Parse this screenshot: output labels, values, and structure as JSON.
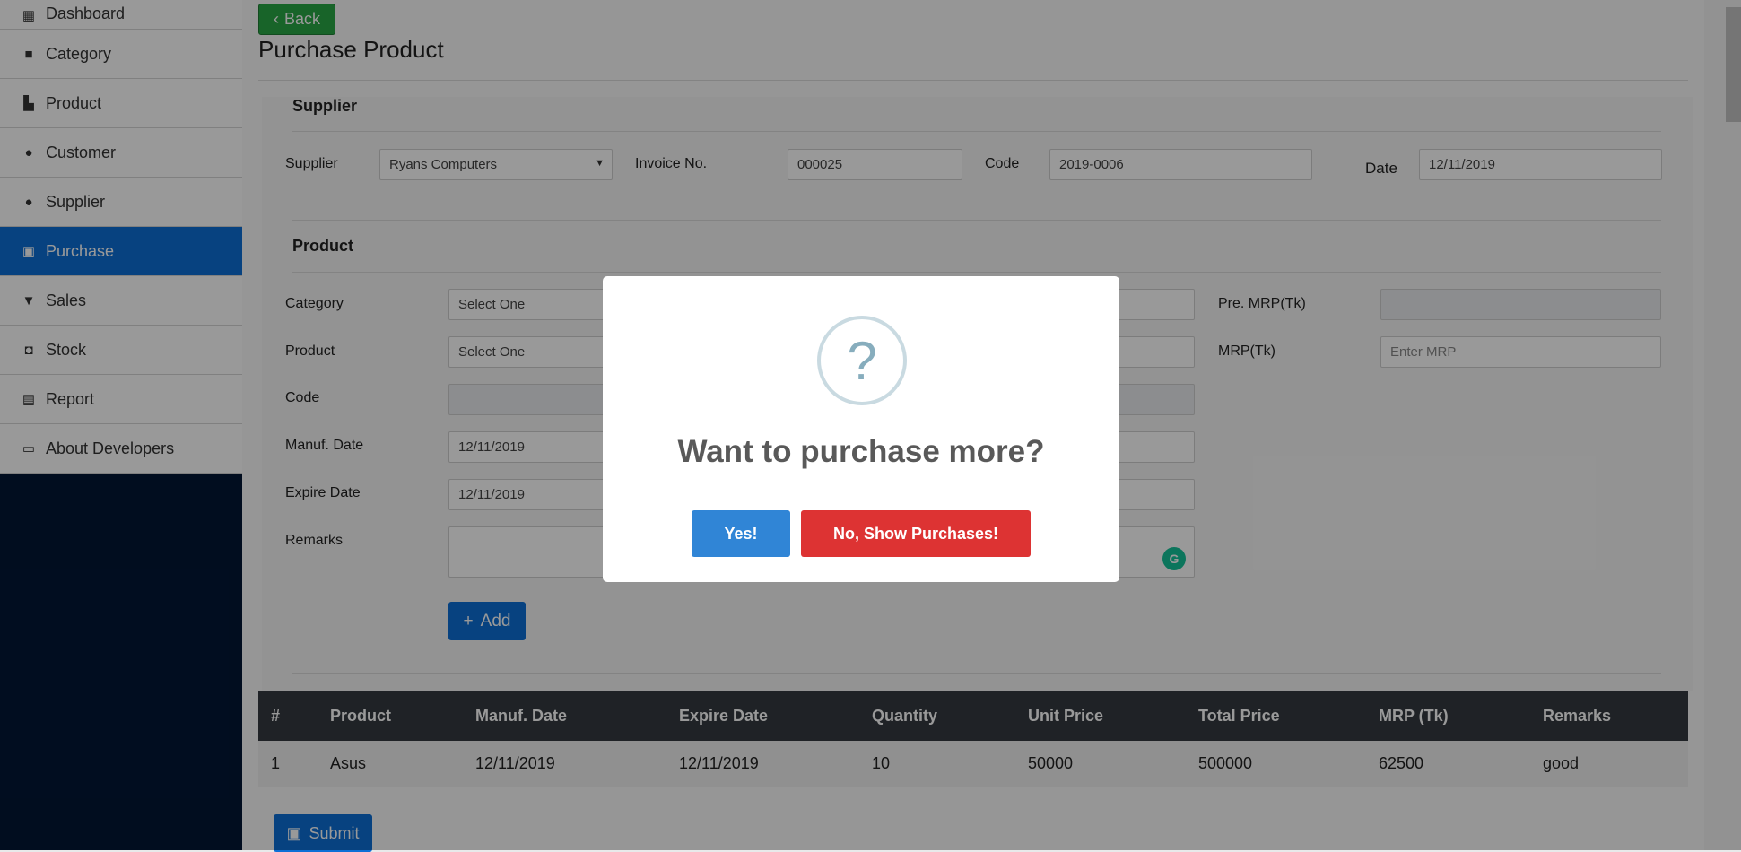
{
  "sidebar": {
    "items": [
      {
        "label": "Dashboard",
        "icon": "dashboard-icon"
      },
      {
        "label": "Category",
        "icon": "folder-icon"
      },
      {
        "label": "Product",
        "icon": "boxes-icon"
      },
      {
        "label": "Customer",
        "icon": "users-icon"
      },
      {
        "label": "Supplier",
        "icon": "users-icon"
      },
      {
        "label": "Purchase",
        "icon": "money-icon",
        "active": true
      },
      {
        "label": "Sales",
        "icon": "cart-icon"
      },
      {
        "label": "Stock",
        "icon": "box-open-icon"
      },
      {
        "label": "Report",
        "icon": "file-icon"
      },
      {
        "label": "About Developers",
        "icon": "id-card-icon"
      }
    ]
  },
  "header": {
    "back_label": "Back",
    "page_title": "Purchase Product"
  },
  "supplier_section": {
    "title": "Supplier",
    "supplier_label": "Supplier",
    "supplier_value": "Ryans Computers",
    "invoice_label": "Invoice No.",
    "invoice_value": "000025",
    "code_label": "Code",
    "code_value": "2019-0006",
    "date_label": "Date",
    "date_value": "12/11/2019"
  },
  "product_section": {
    "title": "Product",
    "category_label": "Category",
    "category_value": "Select One",
    "product_label": "Product",
    "product_value": "Select One",
    "code_label": "Code",
    "manuf_label": "Manuf. Date",
    "manuf_value": "12/11/2019",
    "expire_label": "Expire Date",
    "expire_value": "12/11/2019",
    "remarks_label": "Remarks",
    "pre_mrp_label": "Pre. MRP(Tk)",
    "mrp_label": "MRP(Tk)",
    "mrp_placeholder": "Enter MRP",
    "add_label": "Add"
  },
  "table": {
    "headers": [
      "#",
      "Product",
      "Manuf. Date",
      "Expire Date",
      "Quantity",
      "Unit Price",
      "Total Price",
      "MRP (Tk)",
      "Remarks"
    ],
    "rows": [
      [
        "1",
        "Asus",
        "12/11/2019",
        "12/11/2019",
        "10",
        "50000",
        "500000",
        "62500",
        "good"
      ]
    ]
  },
  "submit_label": "Submit",
  "modal": {
    "icon_glyph": "?",
    "title": "Want to purchase more?",
    "confirm_label": "Yes!",
    "cancel_label": "No, Show Purchases!"
  },
  "colors": {
    "sidebar_bg": "#021635",
    "active": "#0d6fd6",
    "back_btn": "#28a745",
    "table_head": "#343a40",
    "confirm": "#3085d6",
    "cancel": "#dd3333"
  }
}
